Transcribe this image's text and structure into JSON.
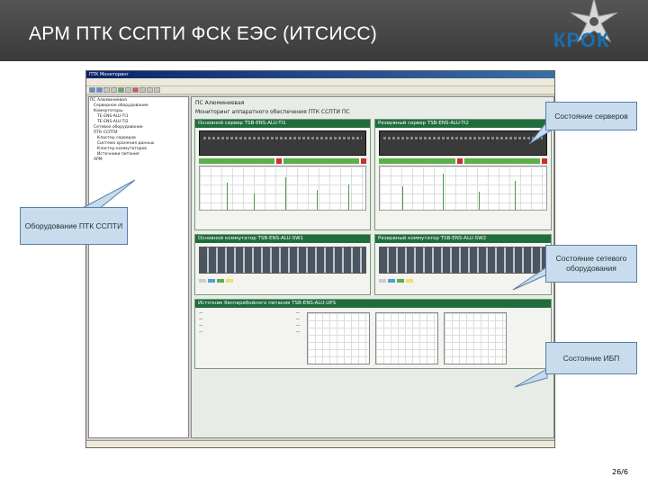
{
  "slide": {
    "title": "АРМ ПТК ССПТИ ФСК ЕЭС (ИТСИСС)",
    "logo": "КРОК",
    "page_number": "26/6"
  },
  "app": {
    "title_text": "ПТК Мониторинг",
    "ps_title": "ПС Алюминиевая",
    "ps_subtitle": "Мониторинг аппаратного обеспечения ПТК ССПТИ ПС",
    "tree_items": [
      "ПС Алюминиевая",
      "Серверное оборудование",
      "Коммутаторы",
      "ТЕ-ENS-ALU-TI1",
      "ТЕ-ENS-ALU-TI2",
      "Сетевое оборудование",
      "ПТК ССПТИ",
      "Кластер серверов",
      "Система хранения данных",
      "Кластер коммутаторов",
      "Источники питания",
      "АРМ"
    ],
    "server_main": "Основной сервер    TSB-ENS-ALU-TI1",
    "server_reserve": "Резервный сервер    TSB-ENS-ALU-TI2",
    "switch_main": "Основной коммутатор    TSB-ENS-ALU-SW1",
    "switch_reserve": "Резервный коммутатор    TSB-ENS-ALU-SW2",
    "ups": "Источник бесперебойного питания    TSB-ENS-ALU-UPS"
  },
  "callouts": {
    "servers": "Состояние серверов",
    "equipment": "Оборудование ПТК ССПТИ",
    "network": "Состояние сетевого оборудования",
    "ups": "Состояние ИБП"
  },
  "colors": {
    "header_green": "#1f6d3d",
    "callout_bg": "#c8dcee",
    "logo_blue": "#1a6fb0"
  }
}
